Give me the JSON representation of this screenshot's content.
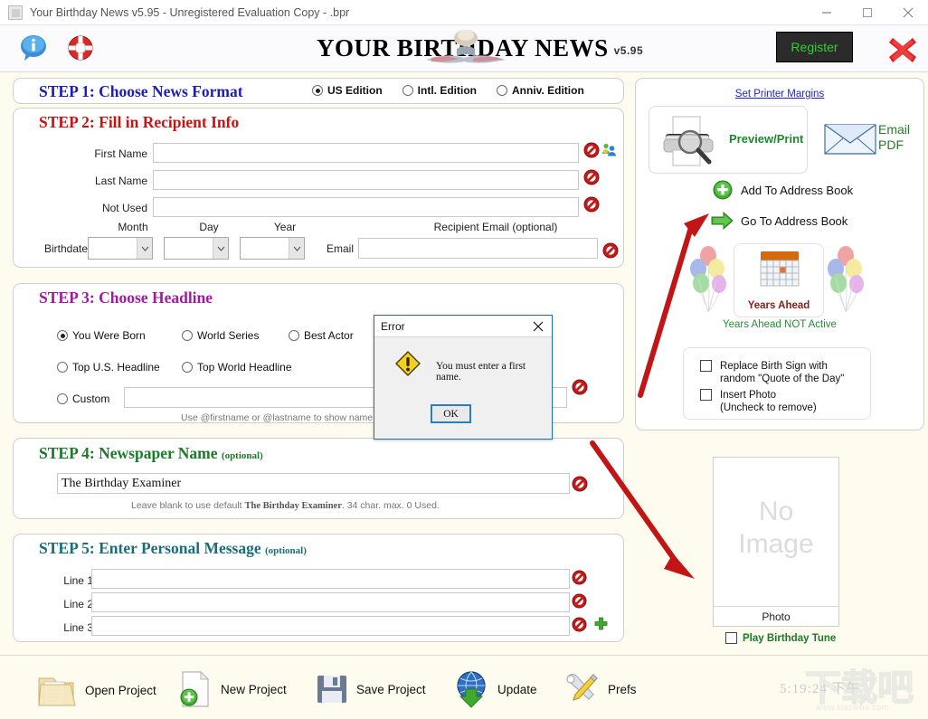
{
  "window": {
    "title": "Your Birthday News v5.95 - Unregistered Evaluation Copy - .bpr",
    "minimize": "—",
    "maximize": "□",
    "close": "✕"
  },
  "header": {
    "masthead": "YOUR BIRTHDAY NEWS",
    "version": "v5.95",
    "register_label": "Register",
    "info_icon": "info-icon",
    "help_icon": "lifering-icon",
    "close_icon": "red-x-icon"
  },
  "step1": {
    "title": "STEP 1: Choose News Format",
    "options": [
      {
        "label": "US Edition",
        "selected": true
      },
      {
        "label": "Intl. Edition",
        "selected": false
      },
      {
        "label": "Anniv. Edition",
        "selected": false
      }
    ]
  },
  "step2": {
    "title": "STEP 2: Fill in Recipient Info",
    "fields": [
      {
        "label": "First Name",
        "value": ""
      },
      {
        "label": "Last Name",
        "value": ""
      },
      {
        "label": "Not Used",
        "value": ""
      }
    ],
    "col_month": "Month",
    "col_day": "Day",
    "col_year": "Year",
    "birthdate_label": "Birthdate",
    "month_value": "",
    "day_value": "",
    "year_value": "",
    "email_caption": "Recipient Email (optional)",
    "email_label": "Email",
    "email_value": ""
  },
  "step3": {
    "title": "STEP 3: Choose Headline",
    "options": [
      {
        "label": "You Were Born",
        "selected": true
      },
      {
        "label": "World Series",
        "selected": false
      },
      {
        "label": "Best Actor",
        "selected": false
      },
      {
        "label": "Top U.S. Headline",
        "selected": false
      },
      {
        "label": "Top World Headline",
        "selected": false
      }
    ],
    "custom_label": "Custom",
    "custom_value": "",
    "hint": "Use @firstname or @lastname to show name in headline"
  },
  "step4": {
    "title": "STEP 4: Newspaper Name",
    "optional": "(optional)",
    "value": "The Birthday Examiner",
    "hint_pre": "Leave blank to use default ",
    "hint_name": "The Birthday Examiner",
    "hint_post": ". 34 char. max. 0 Used."
  },
  "step5": {
    "title": "STEP 5: Enter Personal Message",
    "optional": "(optional)",
    "lines": [
      {
        "label": "Line 1",
        "value": ""
      },
      {
        "label": "Line 2",
        "value": ""
      },
      {
        "label": "Line 3",
        "value": ""
      }
    ]
  },
  "sidebar": {
    "printer_margins_link": "Set Printer Margins",
    "preview_print": "Preview/Print",
    "email_pdf_line1": "Email",
    "email_pdf_line2": "PDF",
    "add_address_book": "Add To Address Book",
    "go_address_book": "Go To Address Book",
    "years_ahead": "Years Ahead",
    "years_ahead_status": "Years Ahead NOT Active",
    "checkbox_quote_line1": "Replace Birth Sign with",
    "checkbox_quote_line2": "random \"Quote of the Day\"",
    "checkbox_photo_line1": "Insert Photo",
    "checkbox_photo_line2": "(Uncheck to remove)",
    "photo_placeholder_line1": "No",
    "photo_placeholder_line2": "Image",
    "photo_caption": "Photo",
    "play_tune": "Play Birthday Tune"
  },
  "toolbar": {
    "open_project": "Open Project",
    "new_project": "New Project",
    "save_project": "Save Project",
    "update": "Update",
    "prefs": "Prefs",
    "clock": "5:19:24 下午",
    "watermark_text": "下载吧",
    "watermark_url": "www.xiazaiba.com"
  },
  "error_dialog": {
    "title": "Error",
    "message": "You must enter a first name.",
    "ok_label": "OK",
    "close_label": "✕"
  },
  "colors": {
    "step1": "#1d1dbb",
    "step2": "#cc1111",
    "step3": "#a21aa2",
    "step4": "#1a7a2a",
    "step5": "#1a6e7a",
    "register_text": "#2fd02f",
    "background": "#fdfcef"
  }
}
